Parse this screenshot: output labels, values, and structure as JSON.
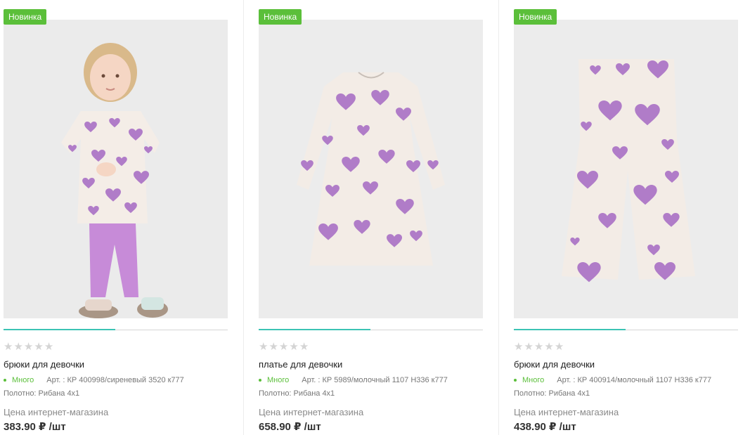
{
  "products": [
    {
      "badge": "Новинка",
      "image_alt": "girl-in-heart-print-outfit",
      "title": "брюки для девочки",
      "stock": "Много",
      "article": "Арт. : КР 400998/сиреневый 3520 к777",
      "fabric": "Полотно: Рибана 4х1",
      "price_label": "Цена интернет-магазина",
      "price": "383.90 ₽ /шт",
      "rating": 0
    },
    {
      "badge": "Новинка",
      "image_alt": "heart-print-dress",
      "title": "платье для девочки",
      "stock": "Много",
      "article": "Арт. : КР 5989/молочный 1107 Н336 к777",
      "fabric": "Полотно: Рибана 4х1",
      "price_label": "Цена интернет-магазина",
      "price": "658.90 ₽ /шт",
      "rating": 0
    },
    {
      "badge": "Новинка",
      "image_alt": "heart-print-flared-pants",
      "title": "брюки для девочки",
      "stock": "Много",
      "article": "Арт. : КР 400914/молочный 1107 Н336 к777",
      "fabric": "Полотно: Рибана 4х1",
      "price_label": "Цена интернет-магазина",
      "price": "438.90 ₽ /шт",
      "rating": 0
    }
  ],
  "colors": {
    "badge": "#5bbf3a",
    "stock": "#5bbf3a",
    "slider_active": "#3cc3b4",
    "heart_purple": "#b07cc8",
    "fabric_cream": "#f3ece6"
  },
  "icons": {
    "star": "star-icon",
    "stock": "stock-dot-icon"
  }
}
